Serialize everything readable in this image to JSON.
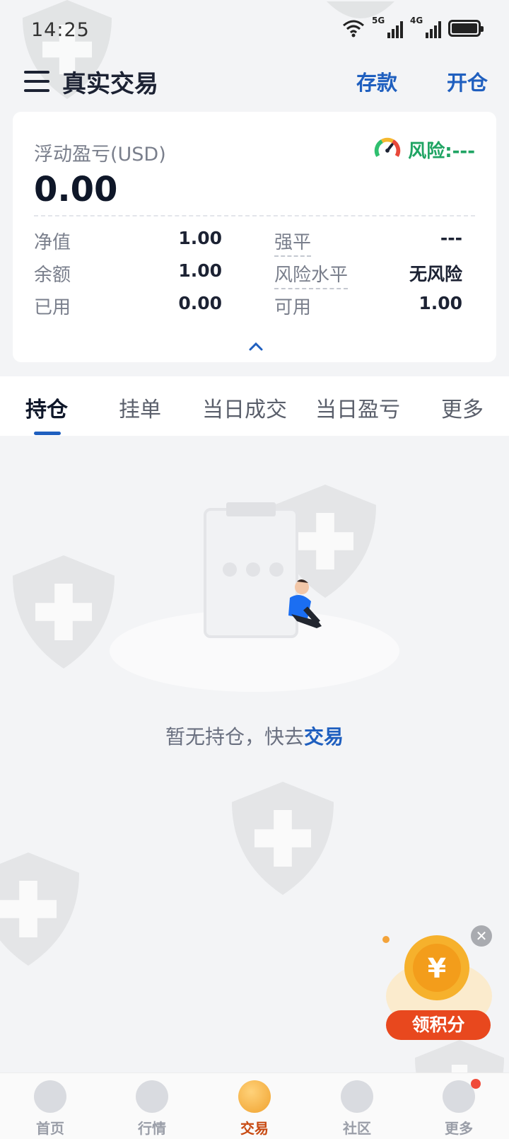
{
  "status": {
    "time": "14:25",
    "network1": "5G",
    "network2": "4G"
  },
  "header": {
    "title": "真实交易",
    "deposit": "存款",
    "open": "开仓"
  },
  "account": {
    "float_label": "浮动盈亏(USD)",
    "float_value": "0.00",
    "risk_label": "风险:---",
    "metrics": [
      {
        "label": "净值",
        "value": "1.00"
      },
      {
        "label": "余额",
        "value": "1.00"
      },
      {
        "label": "已用",
        "value": "0.00"
      },
      {
        "label": "强平",
        "value": "---"
      },
      {
        "label": "风险水平",
        "value": "无风险"
      },
      {
        "label": "可用",
        "value": "1.00"
      }
    ]
  },
  "tabs": [
    "持仓",
    "挂单",
    "当日成交",
    "当日盈亏",
    "更多"
  ],
  "empty": {
    "text": "暂无持仓，快去",
    "link": "交易"
  },
  "reward": {
    "label": "领积分"
  },
  "nav": [
    {
      "label": "首页",
      "icon": "home-icon"
    },
    {
      "label": "行情",
      "icon": "market-icon"
    },
    {
      "label": "交易",
      "icon": "trade-icon"
    },
    {
      "label": "社区",
      "icon": "community-icon"
    },
    {
      "label": "更多",
      "icon": "more-icon"
    }
  ],
  "colors": {
    "accent": "#1f5fbf",
    "risk_green": "#1fa463",
    "active_nav": "#c84a12"
  }
}
